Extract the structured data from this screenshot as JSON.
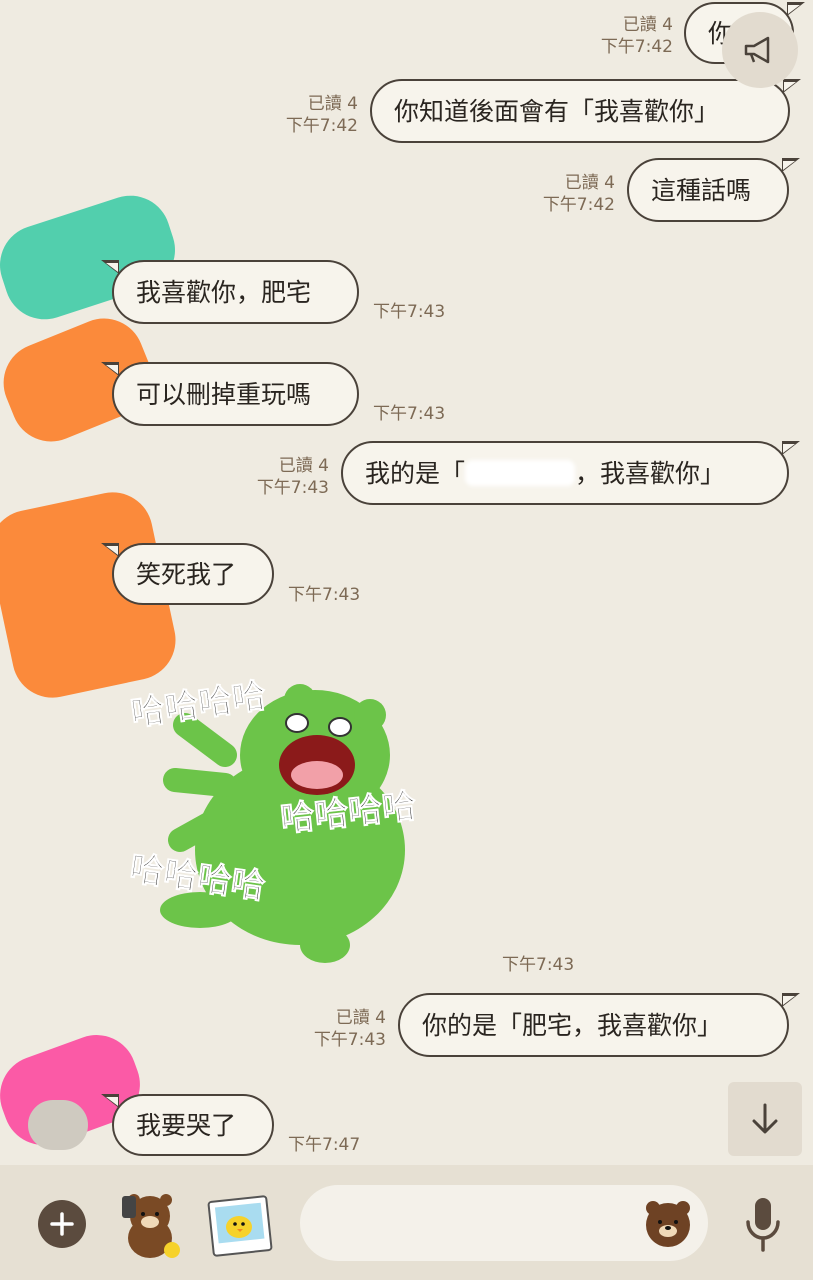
{
  "messages": [
    {
      "dir": "out",
      "read": "已讀 4",
      "time": "下午7:42",
      "text": "你"
    },
    {
      "dir": "out",
      "read": "已讀 4",
      "time": "下午7:42",
      "text": "你知道後面會有「我喜歡你」"
    },
    {
      "dir": "out",
      "read": "已讀 4",
      "time": "下午7:42",
      "text": "這種話嗎"
    },
    {
      "dir": "in",
      "time": "下午7:43",
      "text": "我喜歡你，肥宅"
    },
    {
      "dir": "in",
      "time": "下午7:43",
      "text": "可以刪掉重玩嗎"
    },
    {
      "dir": "out",
      "read": "已讀 4",
      "time": "下午7:43",
      "text_before": "我的是「",
      "text_after": "，我喜歡你」"
    },
    {
      "dir": "in",
      "time": "下午7:43",
      "text": "笑死我了"
    },
    {
      "dir": "in",
      "type": "sticker",
      "time": "下午7:43",
      "sticker_text": [
        "哈哈哈哈",
        "哈哈哈哈",
        "哈哈哈哈"
      ]
    },
    {
      "dir": "out",
      "read": "已讀 4",
      "time": "下午7:43",
      "text": "你的是「肥宅，我喜歡你」"
    },
    {
      "dir": "in",
      "time": "下午7:47",
      "text": "我要哭了"
    }
  ],
  "icons": {
    "announce": "megaphone-icon",
    "scroll_down": "arrow-down-icon",
    "add": "plus-icon",
    "sticker_shop": "bear-sticker-icon",
    "photo": "photo-icon",
    "emoji": "bear-face-icon",
    "mic": "microphone-icon"
  },
  "colors": {
    "background": "#efebe1",
    "bubble": "#f7f4ec",
    "border": "#4a423a",
    "meta": "#7d6a55",
    "sticker_green": "#6cc449"
  }
}
